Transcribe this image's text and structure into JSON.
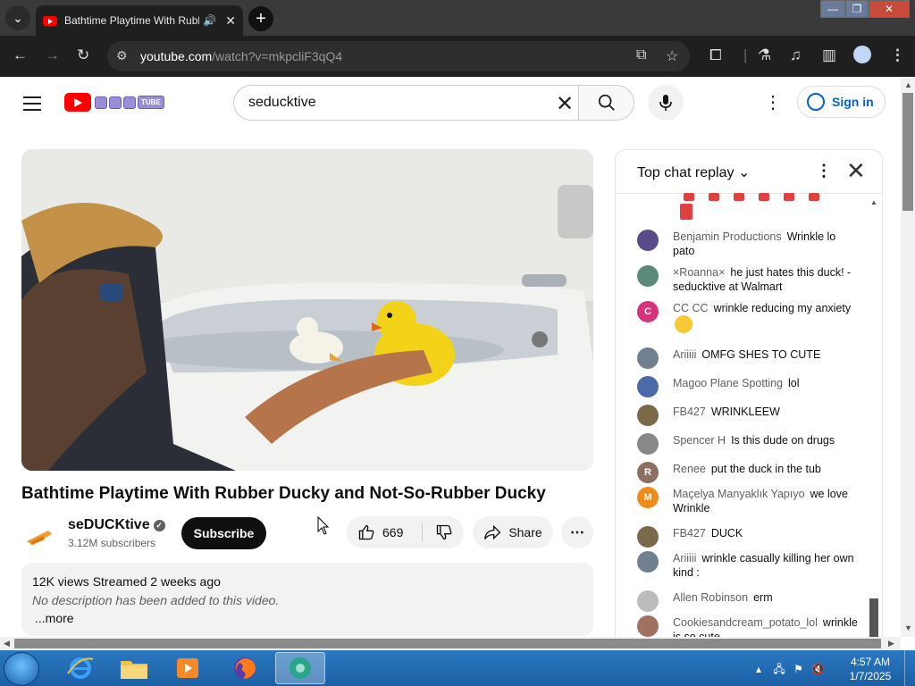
{
  "browser": {
    "tab_title": "Bathtime Playtime With Rubber Ducky and Not-So-Rubber Ducky",
    "url_host": "youtube.com",
    "url_path": "/watch?v=mkpcliF3qQ4",
    "window_buttons": {
      "minimize": "—",
      "maximize": "❐",
      "close": "✕"
    },
    "new_tab_label": "+"
  },
  "header": {
    "search_value": "seducktive",
    "signin_label": "Sign in",
    "logo_badge": "TUBE"
  },
  "video": {
    "title": "Bathtime Playtime With Rubber Ducky and Not-So-Rubber Ducky",
    "channel_name": "seDUCKtive",
    "subscribers": "3.12M subscribers",
    "subscribe_label": "Subscribe",
    "likes": "669",
    "share_label": "Share",
    "views_line": "12K views  Streamed 2 weeks ago",
    "description": "No description has been added to this video.",
    "more_label": "...more"
  },
  "chat": {
    "mode_label": "Top chat replay",
    "messages": [
      {
        "author": "Benjamin Productions",
        "text": "Wrinkle lo pato",
        "avatar_color": "#5b4a8a",
        "initial": ""
      },
      {
        "author": "×Roanna×",
        "text": "he just hates this duck! -seducktive at Walmart",
        "avatar_color": "#5a8a7a",
        "initial": ""
      },
      {
        "author": "CC CC",
        "text": "wrinkle reducing my anxiety",
        "avatar_color": "#d6337a",
        "initial": "C"
      },
      {
        "author": "Ariiiii",
        "text": "OMFG SHES TO CUTE",
        "avatar_color": "#708090",
        "initial": ""
      },
      {
        "author": "Magoo Plane Spotting",
        "text": "lol",
        "avatar_color": "#4a6aa8",
        "initial": ""
      },
      {
        "author": "FB427",
        "text": "WRINKLEEW",
        "avatar_color": "#7a6a4a",
        "initial": ""
      },
      {
        "author": "Spencer H",
        "text": "Is this dude on drugs",
        "avatar_color": "#888888",
        "initial": ""
      },
      {
        "author": "Renee",
        "text": "put the duck in the tub",
        "avatar_color": "#8d6e63",
        "initial": "R"
      },
      {
        "author": "Maçelya Manyaklık Yapıyo",
        "text": "we love Wrinkle",
        "avatar_color": "#ef8a1a",
        "initial": "M"
      },
      {
        "author": "FB427",
        "text": "DUCK",
        "avatar_color": "#7a6a4a",
        "initial": ""
      },
      {
        "author": "Ariiiii",
        "text": "wrinkle casually killing her own kind :",
        "avatar_color": "#708090",
        "initial": ""
      },
      {
        "author": "Allen Robinson",
        "text": "erm",
        "avatar_color": "#bbbbbb",
        "initial": ""
      },
      {
        "author": "Cookiesandcream_potato_lol",
        "text": "wrinkle is so cute",
        "avatar_color": "#a07060",
        "initial": ""
      }
    ]
  },
  "taskbar": {
    "time": "4:57 AM",
    "date": "1/7/2025"
  },
  "colors": {
    "accent_blue": "#065fd4",
    "youtube_red": "#ff0000",
    "taskbar_blue": "#1c5fa5"
  }
}
